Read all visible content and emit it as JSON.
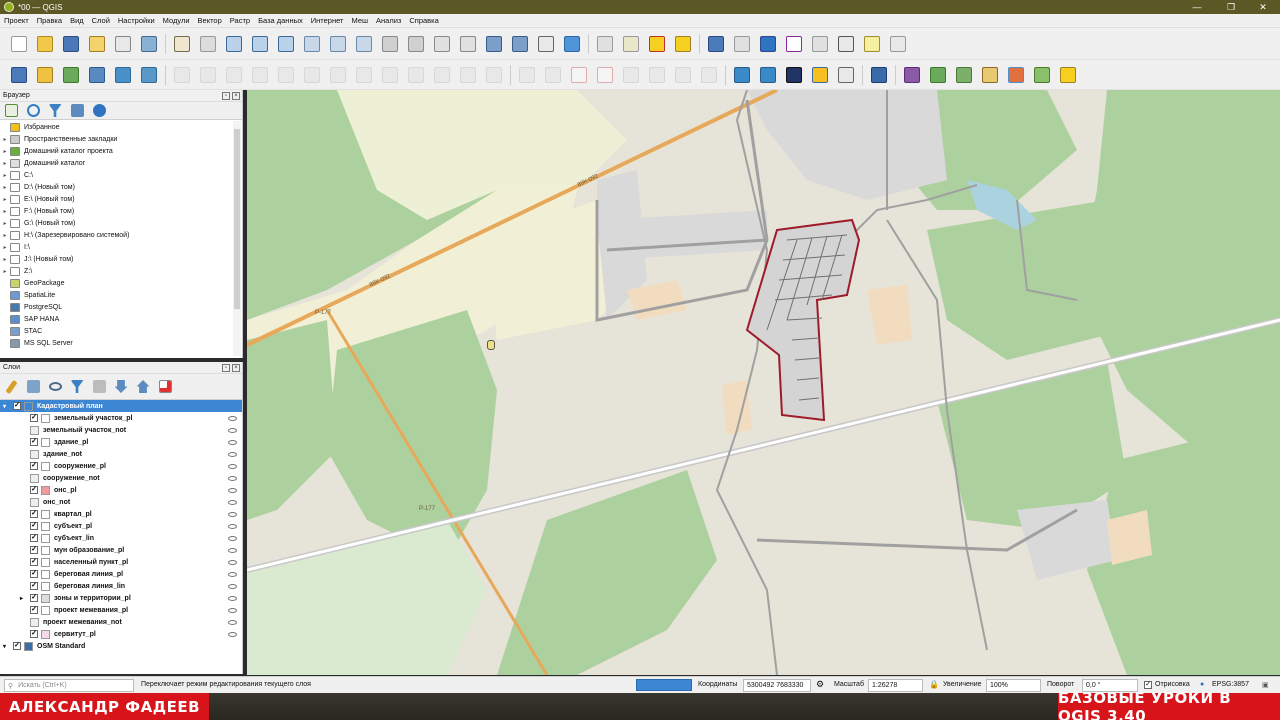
{
  "window": {
    "title": "*00 — QGIS",
    "minimize": "—",
    "maximize": "❐",
    "close": "✕"
  },
  "menu": [
    "Проект",
    "Правка",
    "Вид",
    "Слой",
    "Настройки",
    "Модули",
    "Вектор",
    "Растр",
    "База данных",
    "Интернет",
    "Меш",
    "Анализ",
    "Справка"
  ],
  "browser": {
    "title": "Браузер",
    "items": [
      {
        "label": "Избранное",
        "icon": "star-icon",
        "color": "#f2c21b",
        "arrow": ""
      },
      {
        "label": "Пространственные закладки",
        "icon": "bookmark-icon",
        "color": "#cccccc",
        "arrow": "▸"
      },
      {
        "label": "Домашний каталог проекта",
        "icon": "project-home-icon",
        "color": "#6cae3d",
        "arrow": "▸"
      },
      {
        "label": "Домашний каталог",
        "icon": "home-folder-icon",
        "color": "#dddddd",
        "arrow": "▸"
      },
      {
        "label": "C:\\",
        "icon": "drive-icon",
        "color": "#ffffff",
        "arrow": "▸"
      },
      {
        "label": "D:\\ (Новый том)",
        "icon": "drive-icon",
        "color": "#ffffff",
        "arrow": "▸"
      },
      {
        "label": "E:\\ (Новый том)",
        "icon": "drive-icon",
        "color": "#ffffff",
        "arrow": "▸"
      },
      {
        "label": "F:\\ (Новый том)",
        "icon": "drive-icon",
        "color": "#ffffff",
        "arrow": "▸"
      },
      {
        "label": "G:\\ (Новый том)",
        "icon": "drive-icon",
        "color": "#ffffff",
        "arrow": "▸"
      },
      {
        "label": "H:\\ (Зарезервировано системой)",
        "icon": "drive-icon",
        "color": "#ffffff",
        "arrow": "▸"
      },
      {
        "label": "I:\\",
        "icon": "drive-icon",
        "color": "#ffffff",
        "arrow": "▸"
      },
      {
        "label": "J:\\ (Новый том)",
        "icon": "drive-icon",
        "color": "#ffffff",
        "arrow": "▸"
      },
      {
        "label": "Z:\\",
        "icon": "drive-icon",
        "color": "#ffffff",
        "arrow": "▸"
      },
      {
        "label": "GeoPackage",
        "icon": "geopackage-icon",
        "color": "#c8d36a",
        "arrow": ""
      },
      {
        "label": "SpatiaLite",
        "icon": "spatialite-icon",
        "color": "#6b9bd1",
        "arrow": ""
      },
      {
        "label": "PostgreSQL",
        "icon": "postgresql-icon",
        "color": "#4a7aa8",
        "arrow": ""
      },
      {
        "label": "SAP HANA",
        "icon": "sap-hana-icon",
        "color": "#5a8fc8",
        "arrow": ""
      },
      {
        "label": "STAC",
        "icon": "stac-icon",
        "color": "#7aa0c8",
        "arrow": ""
      },
      {
        "label": "MS SQL Server",
        "icon": "mssql-icon",
        "color": "#8899aa",
        "arrow": ""
      }
    ]
  },
  "layers": {
    "title": "Слои",
    "items": [
      {
        "label": "Кадастровый план",
        "checked": "✓",
        "swatch": "#3d86d4",
        "indent": 0,
        "selected": true,
        "expand": "▾"
      },
      {
        "label": "земельный участок_pl",
        "checked": "✓",
        "swatch": "#ffffff",
        "indent": 1,
        "expand": ""
      },
      {
        "label": "земельный участок_not",
        "checked": "",
        "swatch": "#eeeeee",
        "indent": 1,
        "nocb": true,
        "expand": ""
      },
      {
        "label": "здание_pl",
        "checked": "✓",
        "swatch": "#ffffff",
        "indent": 1,
        "expand": ""
      },
      {
        "label": "здание_not",
        "checked": "",
        "swatch": "#eeeeee",
        "indent": 1,
        "nocb": true,
        "expand": ""
      },
      {
        "label": "сооружение_pl",
        "checked": "✓",
        "swatch": "#ffffff",
        "indent": 1,
        "expand": ""
      },
      {
        "label": "сооружение_not",
        "checked": "",
        "swatch": "#eeeeee",
        "indent": 1,
        "nocb": true,
        "expand": ""
      },
      {
        "label": "онс_pl",
        "checked": "✓",
        "swatch": "#f09aa0",
        "indent": 1,
        "expand": ""
      },
      {
        "label": "онс_not",
        "checked": "",
        "swatch": "#eeeeee",
        "indent": 1,
        "nocb": true,
        "expand": ""
      },
      {
        "label": "квартал_pl",
        "checked": "✓",
        "swatch": "#ffffff",
        "indent": 1,
        "expand": ""
      },
      {
        "label": "субъект_pl",
        "checked": "✓",
        "swatch": "#ffffff",
        "indent": 1,
        "expand": ""
      },
      {
        "label": "субъект_lin",
        "checked": "✓",
        "swatch": "#ffffff",
        "indent": 1,
        "expand": ""
      },
      {
        "label": "мун образование_pl",
        "checked": "✓",
        "swatch": "#ffffff",
        "indent": 1,
        "expand": ""
      },
      {
        "label": "населенный пункт_pl",
        "checked": "✓",
        "swatch": "#ffffff",
        "indent": 1,
        "expand": ""
      },
      {
        "label": "береговая линия_pl",
        "checked": "✓",
        "swatch": "#ffffff",
        "indent": 1,
        "expand": ""
      },
      {
        "label": "береговая линия_lin",
        "checked": "✓",
        "swatch": "#ffffff",
        "indent": 1,
        "expand": ""
      },
      {
        "label": "зоны и территории_pl",
        "checked": "✓",
        "swatch": "#dddddd",
        "indent": 1,
        "expand": "▸"
      },
      {
        "label": "проект межевания_pl",
        "checked": "✓",
        "swatch": "#ffffff",
        "indent": 1,
        "expand": ""
      },
      {
        "label": "проект межевания_not",
        "checked": "",
        "swatch": "#eeeeee",
        "indent": 1,
        "nocb": true,
        "expand": ""
      },
      {
        "label": "сервитут_pl",
        "checked": "✓",
        "swatch": "#f4d8ec",
        "indent": 1,
        "expand": ""
      },
      {
        "label": "OSM Standard",
        "checked": "✓",
        "swatch": "#3b6ea5",
        "indent": 0,
        "expand": "▾"
      }
    ]
  },
  "map_labels": {
    "road1": "88К-092",
    "road2": "88К-092",
    "road3": "Р-177",
    "road4": "Р-177"
  },
  "statusbar": {
    "search_placeholder": "Искать (Ctrl+K)",
    "message": "Переключает режим редактирования текущего слоя",
    "coords_label": "Координаты",
    "coords_value": "5300492  7683330",
    "scale_label": "Масштаб",
    "scale_value": "1:26278",
    "magnifier_label": "Увеличение",
    "magnifier_value": "100%",
    "rotation_label": "Поворот",
    "rotation_value": "0,0 °",
    "render_label": "Отрисовка",
    "crs": "EPSG:3857"
  },
  "overlay": {
    "author": "АЛЕКСАНДР ФАДЕЕВ",
    "course": "БАЗОВЫЕ УРОКИ В QGIS 3.40"
  },
  "colors": {
    "selection": "#3d86d4",
    "forest": "#add19e",
    "meadow": "#eef0d5",
    "parcel_outline": "#9e1b2a",
    "banner": "#d8141b"
  }
}
